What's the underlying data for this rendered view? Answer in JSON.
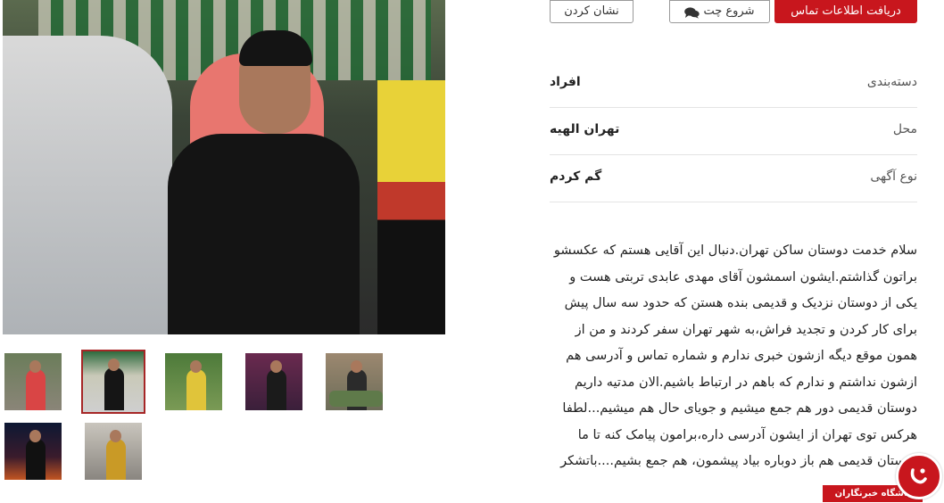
{
  "actions": {
    "contact_label": "دریافت اطلاعات تماس",
    "chat_label": "شروع چت",
    "mark_label": "نشان کردن"
  },
  "info": [
    {
      "label": "دسته‌بندی",
      "value": "افراد"
    },
    {
      "label": "محل",
      "value": "تهران الهیه"
    },
    {
      "label": "نوع آگهی",
      "value": "گم کردم"
    }
  ],
  "description": "سلام خدمت دوستان ساکن تهران.دنبال این آقایی هستم که عکسشو براتون گذاشتم.ایشون اسمشون آقای مهدی عابدی تربتی هست و یکی از دوستان نزدیک و قدیمی بنده هستن که حدود سه سال پیش برای کار کردن و تجدید فراش،به شهر تهران سفر کردند و من از همون موقع دیگه ازشون خبری ندارم و شماره تماس و آدرسی هم ازشون نداشتم و ندارم که باهم در ارتباط باشیم.الان مدتیه داریم دوستان قدیمی دور هم جمع میشیم و جویای حال هم میشیم...لطفا هرکس توی تهران از ایشون آدرسی داره،برامون پیامک کنه تا ما دوستان قدیمی هم باز دوباره بیاد پیشمون، هم جمع بشیم....باتشکر",
  "gallery": {
    "thumbnail_count": 7,
    "selected_index": 1
  },
  "badge": {
    "text": "باشگاه خبرنگاران"
  },
  "colors": {
    "accent": "#c8161d",
    "selected_thumb_border": "#a62626"
  }
}
